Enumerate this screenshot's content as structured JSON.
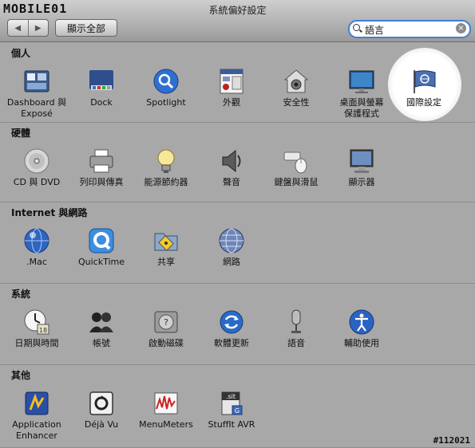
{
  "app": {
    "logo_text": "MOBILE01",
    "window_title": "系統偏好設定",
    "show_all_label": "顯示全部"
  },
  "search": {
    "value": "語言"
  },
  "sections": [
    {
      "title": "個人",
      "items": [
        {
          "label": "Dashboard 與\nExposé",
          "icon": "dashboard-icon"
        },
        {
          "label": "Dock",
          "icon": "dock-icon"
        },
        {
          "label": "Spotlight",
          "icon": "spotlight-icon"
        },
        {
          "label": "外觀",
          "icon": "appearance-icon"
        },
        {
          "label": "安全性",
          "icon": "security-icon"
        },
        {
          "label": "桌面與螢幕\n保護程式",
          "icon": "desktop-icon"
        },
        {
          "label": "國際設定",
          "icon": "international-flag-icon"
        }
      ]
    },
    {
      "title": "硬體",
      "items": [
        {
          "label": "CD 與 DVD",
          "icon": "cd-icon"
        },
        {
          "label": "列印與傳真",
          "icon": "printer-icon"
        },
        {
          "label": "能源節約器",
          "icon": "bulb-icon"
        },
        {
          "label": "聲音",
          "icon": "speaker-icon"
        },
        {
          "label": "鍵盤與滑鼠",
          "icon": "keyboard-mouse-icon"
        },
        {
          "label": "顯示器",
          "icon": "display-icon"
        }
      ]
    },
    {
      "title": "Internet 與網路",
      "items": [
        {
          "label": ".Mac",
          "icon": "mac-globe-icon"
        },
        {
          "label": "QuickTime",
          "icon": "quicktime-icon"
        },
        {
          "label": "共享",
          "icon": "sharing-icon"
        },
        {
          "label": "網路",
          "icon": "network-icon"
        }
      ]
    },
    {
      "title": "系統",
      "items": [
        {
          "label": "日期與時間",
          "icon": "clock-icon"
        },
        {
          "label": "帳號",
          "icon": "accounts-icon"
        },
        {
          "label": "啟動磁碟",
          "icon": "disk-icon"
        },
        {
          "label": "軟體更新",
          "icon": "update-icon"
        },
        {
          "label": "語音",
          "icon": "microphone-icon"
        },
        {
          "label": "輔助使用",
          "icon": "accessibility-icon"
        }
      ]
    },
    {
      "title": "其他",
      "items": [
        {
          "label": "Application\nEnhancer",
          "icon": "application-enhancer-icon"
        },
        {
          "label": "Déjà Vu",
          "icon": "dejavu-icon"
        },
        {
          "label": "MenuMeters",
          "icon": "menumeters-icon"
        },
        {
          "label": "StuffIt AVR",
          "icon": "stuffit-icon"
        }
      ]
    }
  ],
  "watermark": "#112021",
  "colors": {
    "search_border": "#3f7fd8",
    "spotlight_glow": "#ffffff"
  }
}
